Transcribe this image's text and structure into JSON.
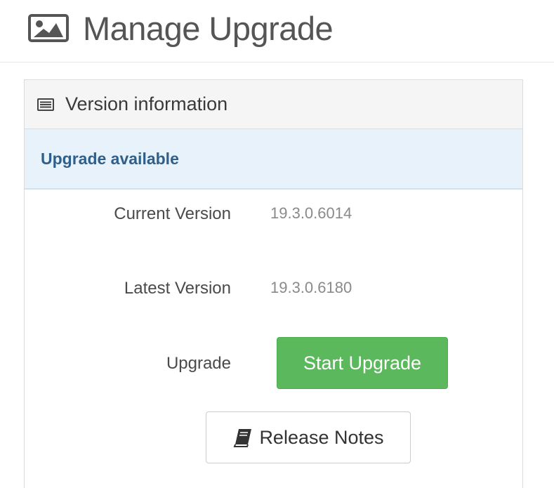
{
  "header": {
    "title": "Manage Upgrade",
    "icon": "image-icon"
  },
  "panel": {
    "title": "Version information",
    "icon": "list-icon",
    "alert": "Upgrade available",
    "rows": [
      {
        "label": "Current Version",
        "value": "19.3.0.6014"
      },
      {
        "label": "Latest Version",
        "value": "19.3.0.6180"
      },
      {
        "label": "Upgrade"
      }
    ],
    "start_button_label": "Start Upgrade",
    "release_notes_label": "Release Notes",
    "release_notes_icon": "book-icon"
  },
  "colors": {
    "success": "#5cb85c",
    "alert_background": "#e8f2fb",
    "alert_text": "#2f5f8a"
  }
}
